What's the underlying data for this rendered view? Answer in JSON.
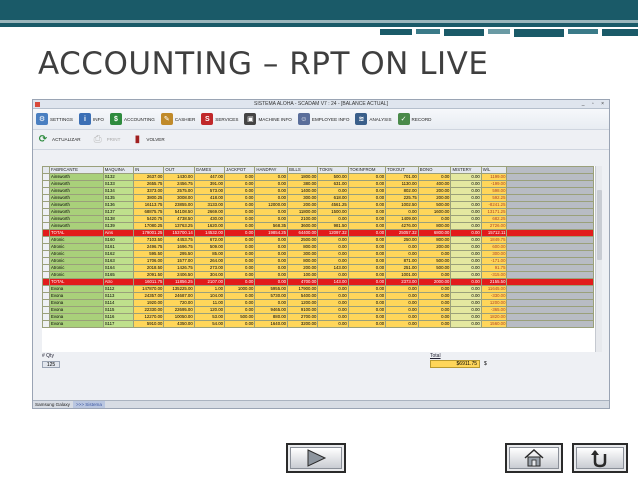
{
  "slide": {
    "title": "ACCOUNTING – RPT ON LIVE"
  },
  "window": {
    "title": "SISTEMA ALOHA - SCADAM V7 : 24 - [BALANCE ACTUAL]",
    "controls": "_ ▫ ×"
  },
  "toolbar": {
    "items": [
      {
        "label": "SETTINGS",
        "icon": "settings-icon",
        "color": "#4a7fc1",
        "glyph": "⚙"
      },
      {
        "label": "INFO",
        "icon": "info-icon",
        "color": "#3b6fb5",
        "glyph": "i"
      },
      {
        "label": "ACCOUNTING",
        "icon": "dollar-icon",
        "color": "#2e8b3e",
        "glyph": "$"
      },
      {
        "label": "CASHIER",
        "icon": "cashier-icon",
        "color": "#c08a2a",
        "glyph": "✎"
      },
      {
        "label": "SERVICES",
        "icon": "sos-icon",
        "color": "#c0282a",
        "glyph": "S"
      },
      {
        "label": "MACHINE INFO",
        "icon": "slot-machine-icon",
        "color": "#444444",
        "glyph": "▣"
      },
      {
        "label": "EMPLOYEE INFO",
        "icon": "employee-icon",
        "color": "#5a6e9a",
        "glyph": "☺"
      },
      {
        "label": "ANALYSIS",
        "icon": "analysis-icon",
        "color": "#3a5f8a",
        "glyph": "≋"
      },
      {
        "label": "RECORD",
        "icon": "record-icon",
        "color": "#4a8a4a",
        "glyph": "✓"
      }
    ]
  },
  "toolbar2": {
    "refresh": {
      "label": "ACTUALIZAR",
      "icon": "refresh-icon"
    },
    "print": {
      "label": "PRINT",
      "icon": "printer-icon"
    },
    "back": {
      "label": "VOLVER",
      "icon": "exit-door-icon"
    }
  },
  "grid": {
    "columns": [
      "FABRICANTE",
      "MAQUINA",
      "IN",
      "OUT",
      "GAMES",
      "JACKPOT",
      "HANDPAY",
      "BILLS",
      "TOKIN",
      "TOKINFROM",
      "TOKOUT",
      "BONO",
      "MISTERY",
      "W/L"
    ],
    "rows": [
      {
        "total": false,
        "cells": [
          "Ainsworth",
          "S132",
          "2637.00",
          "1430.00",
          "447.00",
          "0.00",
          "0.00",
          "1800.00",
          "500.00",
          "0.00",
          "701.00",
          "0.00",
          "0.00",
          "1199.00"
        ]
      },
      {
        "total": false,
        "cells": [
          "Ainsworth",
          "S133",
          "2655.75",
          "2456.75",
          "391.00",
          "0.00",
          "0.00",
          "380.00",
          "631.00",
          "0.00",
          "1130.00",
          "400.00",
          "0.00",
          "-199.00"
        ]
      },
      {
        "total": false,
        "cells": [
          "Ainsworth",
          "S134",
          "3373.00",
          "2575.00",
          "573.00",
          "0.00",
          "0.00",
          "1400.00",
          "0.00",
          "0.00",
          "802.00",
          "200.00",
          "0.00",
          "598.00"
        ]
      },
      {
        "total": false,
        "cells": [
          "Ainsworth",
          "S135",
          "3800.25",
          "3008.00",
          "418.00",
          "0.00",
          "0.00",
          "300.00",
          "618.00",
          "0.00",
          "225.75",
          "200.00",
          "0.00",
          "592.25"
        ]
      },
      {
        "total": false,
        "cells": [
          "Ainsworth",
          "S136",
          "16113.75",
          "23855.00",
          "3133.00",
          "0.00",
          "12000.00",
          "200.00",
          "4561.25",
          "0.00",
          "1002.50",
          "500.00",
          "0.00",
          "-8241.25"
        ]
      },
      {
        "total": false,
        "cells": [
          "Ainsworth",
          "S137",
          "68875.75",
          "54108.50",
          "2669.00",
          "0.00",
          "0.00",
          "11800.00",
          "1500.00",
          "0.00",
          "0.00",
          "1600.00",
          "0.00",
          "13171.25"
        ]
      },
      {
        "total": false,
        "cells": [
          "Ainsworth",
          "S138",
          "5420.75",
          "4738.50",
          "430.00",
          "0.00",
          "0.00",
          "2100.00",
          "0.00",
          "0.00",
          "1409.00",
          "0.00",
          "0.00",
          "682.25"
        ]
      },
      {
        "total": false,
        "cells": [
          "Ainsworth",
          "S139",
          "17080.25",
          "13763.25",
          "1620.00",
          "0.00",
          "568.35",
          "3600.00",
          "981.50",
          "0.00",
          "4276.00",
          "800.00",
          "0.00",
          "2726.00"
        ]
      },
      {
        "total": true,
        "cells": [
          "TOTAL",
          "Ains",
          "179001.25",
          "153700.14",
          "14532.00",
          "0.00",
          "19854.25",
          "64400.00",
          "12097.32",
          "0.00",
          "25057.32",
          "6800.00",
          "0.00",
          "15712.11"
        ]
      },
      {
        "total": false,
        "cells": [
          "Atronic",
          "S160",
          "7103.50",
          "4453.75",
          "672.00",
          "0.00",
          "0.00",
          "2500.00",
          "0.00",
          "0.00",
          "250.00",
          "800.00",
          "0.00",
          "1849.75"
        ]
      },
      {
        "total": false,
        "cells": [
          "Atronic",
          "S161",
          "2496.75",
          "1696.75",
          "509.00",
          "0.00",
          "0.00",
          "800.00",
          "0.00",
          "0.00",
          "0.00",
          "200.00",
          "0.00",
          "600.00"
        ]
      },
      {
        "total": false,
        "cells": [
          "Atronic",
          "S162",
          "595.50",
          "295.50",
          "85.00",
          "0.00",
          "0.00",
          "300.00",
          "0.00",
          "0.00",
          "0.00",
          "0.00",
          "0.00",
          "300.00"
        ]
      },
      {
        "total": false,
        "cells": [
          "Atronic",
          "S163",
          "1706.00",
          "1577.00",
          "264.00",
          "0.00",
          "0.00",
          "800.00",
          "0.00",
          "0.00",
          "871.00",
          "500.00",
          "0.00",
          "-171.00"
        ]
      },
      {
        "total": false,
        "cells": [
          "Atronic",
          "S164",
          "2018.50",
          "1426.75",
          "273.00",
          "0.00",
          "0.00",
          "200.00",
          "143.00",
          "0.00",
          "251.00",
          "500.00",
          "0.00",
          "91.75"
        ]
      },
      {
        "total": false,
        "cells": [
          "Atronic",
          "S165",
          "2091.50",
          "2406.50",
          "304.00",
          "0.00",
          "0.00",
          "100.00",
          "0.00",
          "0.00",
          "1001.00",
          "0.00",
          "0.00",
          "-315.00"
        ]
      },
      {
        "total": true,
        "cells": [
          "TOTAL",
          "Atro",
          "16011.75",
          "11856.25",
          "2107.00",
          "0.00",
          "0.00",
          "4700.00",
          "143.00",
          "0.00",
          "2373.00",
          "2000.00",
          "0.00",
          "2155.50"
        ]
      },
      {
        "total": false,
        "cells": [
          "Evona",
          "S112",
          "147870.00",
          "135225.00",
          "1.00",
          "1000.00",
          "5955.00",
          "17900.00",
          "0.00",
          "0.00",
          "0.00",
          "0.00",
          "0.00",
          "11645.00"
        ]
      },
      {
        "total": false,
        "cells": [
          "Evona",
          "S113",
          "24357.00",
          "24687.00",
          "104.00",
          "0.00",
          "5730.00",
          "5400.00",
          "0.00",
          "0.00",
          "0.00",
          "0.00",
          "0.00",
          "-330.00"
        ]
      },
      {
        "total": false,
        "cells": [
          "Evona",
          "S114",
          "1920.00",
          "720.00",
          "11.00",
          "0.00",
          "0.00",
          "1200.00",
          "0.00",
          "0.00",
          "0.00",
          "0.00",
          "0.00",
          "1200.00"
        ]
      },
      {
        "total": false,
        "cells": [
          "Evona",
          "S115",
          "22330.00",
          "22695.00",
          "120.00",
          "0.00",
          "9465.00",
          "9100.00",
          "0.00",
          "0.00",
          "0.00",
          "0.00",
          "0.00",
          "-365.00"
        ]
      },
      {
        "total": false,
        "cells": [
          "Evona",
          "S116",
          "12270.00",
          "10050.00",
          "53.00",
          "500.00",
          "880.00",
          "2700.00",
          "0.00",
          "0.00",
          "0.00",
          "0.00",
          "0.00",
          "1820.00"
        ]
      },
      {
        "total": false,
        "cells": [
          "Evona",
          "S117",
          "5910.00",
          "4350.00",
          "54.00",
          "0.00",
          "1640.00",
          "3200.00",
          "0.00",
          "0.00",
          "0.00",
          "0.00",
          "0.00",
          "1560.00"
        ]
      }
    ]
  },
  "footer": {
    "qty_label": "# Qty",
    "qty_value": "125",
    "total_label": "Total",
    "total_value": "$6911.75",
    "total_currency": "$"
  },
  "status": {
    "user": "Samsung Galaxy",
    "link": ">>> Sistema"
  },
  "nav": {
    "next": {
      "icon": "play-arrow-icon"
    },
    "home": {
      "icon": "home-icon"
    },
    "back": {
      "icon": "return-arrow-icon"
    }
  },
  "colors": {
    "total_row": "#e21b1b",
    "numeric_cell": "#ffd65a",
    "vendor_cell": "#a9d07a",
    "slide_accent": "#1a5a68"
  }
}
